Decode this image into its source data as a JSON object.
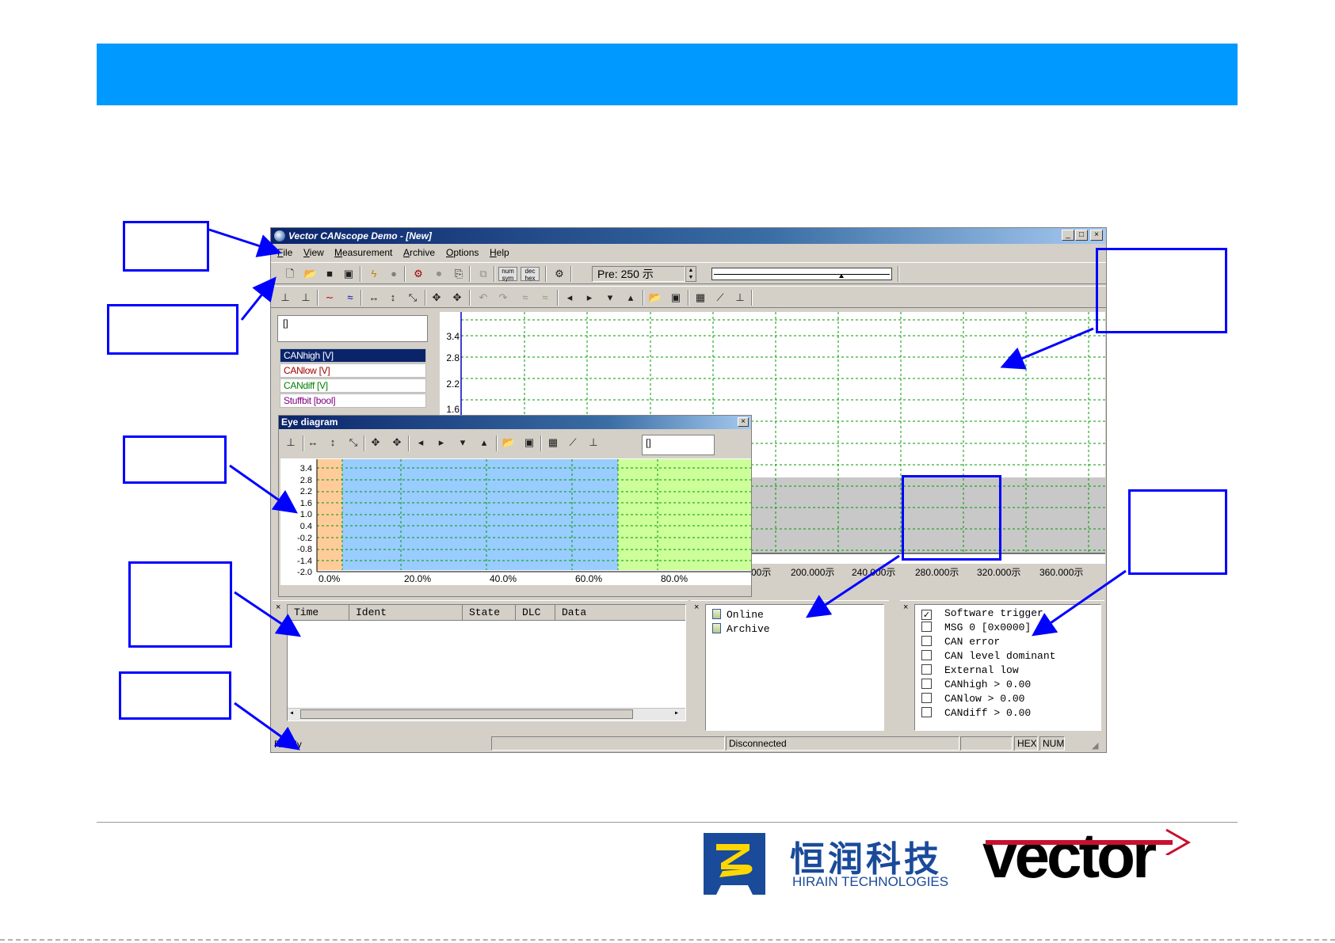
{
  "window": {
    "title": "Vector CANscope Demo  - [New]",
    "buttons": {
      "minimize": "_",
      "maximize": "□",
      "close": "×"
    }
  },
  "menu": [
    "File",
    "View",
    "Measurement",
    "Archive",
    "Options",
    "Help"
  ],
  "toolbar": {
    "num_sym": "num sym",
    "dec_hex": "dec hex",
    "pretrigger": "Pre: 250 示",
    "icons": [
      "new-icon",
      "open-icon",
      "save-icon",
      "save-as-icon",
      "trigger-icon",
      "record-icon",
      "config-icon",
      "stop-icon",
      "export-icon",
      "copy-icon",
      "num-sym-icon",
      "dec-hex-icon",
      "settings-icon"
    ]
  },
  "signals": {
    "name_field": "[]",
    "items": [
      {
        "label": "CANhigh [V]",
        "color": "#ffffff",
        "selected": true
      },
      {
        "label": "CANlow [V]",
        "color": "#a00000",
        "selected": false
      },
      {
        "label": "CANdiff [V]",
        "color": "#008000",
        "selected": false
      },
      {
        "label": "Stuffbit [bool]",
        "color": "#800080",
        "selected": false
      }
    ]
  },
  "main_plot": {
    "y_ticks": [
      "3.4",
      "2.8",
      "2.2",
      "1.6"
    ],
    "x_ticks": [
      "00示",
      "200.000示",
      "240.000示",
      "280.000示",
      "320.000示",
      "360.000示"
    ]
  },
  "eye_diagram": {
    "title": "Eye diagram",
    "close": "×",
    "input_value": "[]",
    "y_ticks": [
      "3.4",
      "2.8",
      "2.2",
      "1.6",
      "1.0",
      "0.4",
      "-0.2",
      "-0.8",
      "-1.4",
      "-2.0"
    ],
    "x_ticks": [
      "0.0%",
      "20.0%",
      "40.0%",
      "60.0%",
      "80.0%"
    ],
    "colors": {
      "orange": "#ffcc99",
      "blue": "#99ccff",
      "green": "#ccff99"
    }
  },
  "trace": {
    "columns": [
      "Time",
      "Ident",
      "State",
      "DLC",
      "Data"
    ]
  },
  "sources": {
    "items": [
      "Online",
      "Archive"
    ]
  },
  "triggers": {
    "items": [
      {
        "label": "Software trigger",
        "checked": true
      },
      {
        "label": "MSG 0 [0x0000]",
        "checked": false
      },
      {
        "label": "CAN error",
        "checked": false
      },
      {
        "label": "CAN level dominant",
        "checked": false
      },
      {
        "label": "External low",
        "checked": false
      },
      {
        "label": "CANhigh > 0.00",
        "checked": false
      },
      {
        "label": "CANlow > 0.00",
        "checked": false
      },
      {
        "label": "CANdiff > 0.00",
        "checked": false
      }
    ]
  },
  "statusbar": {
    "left": "Ready",
    "connection": "Disconnected",
    "hex": "HEX",
    "num": "NUM"
  },
  "logos": {
    "hirain_cn": "恒润科技",
    "hirain_en": "HIRAIN TECHNOLOGIES",
    "vector": "vector"
  },
  "colors": {
    "banner": "#0099ff",
    "annotation": "#0000ff",
    "vector_red": "#c8102e",
    "hirain_blue": "#1a4a9a",
    "hirain_yellow": "#ffd700"
  }
}
